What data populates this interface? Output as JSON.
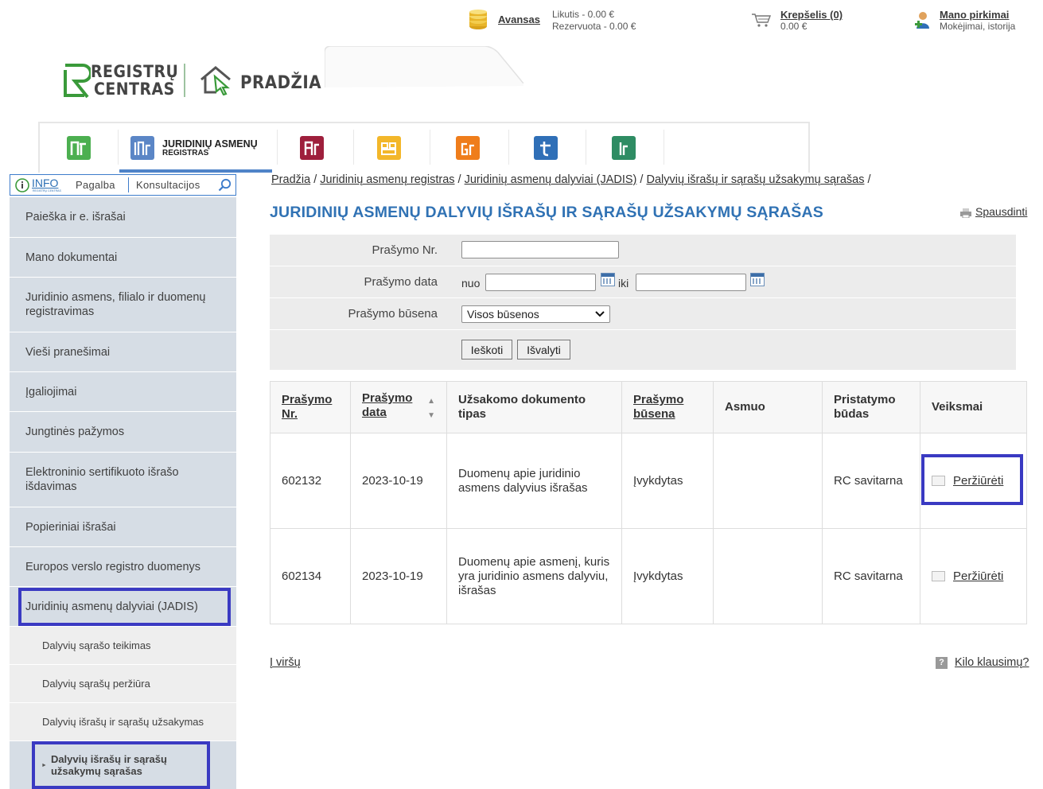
{
  "topbar": {
    "avansas_label": "Avansas",
    "balance_line": "Likutis - 0.00 €",
    "reserved_line": "Rezervuota - 0.00 €",
    "cart_label": "Krepšelis (0)",
    "cart_sum": "0.00 €",
    "purchases_label": "Mano pirkimai",
    "purchases_sub": "Mokėjimai, istorija"
  },
  "logo": {
    "line1": "REGISTRŲ",
    "line2": "CENTRAS",
    "home": "PRADŽIA"
  },
  "registry_tabs": {
    "active_line1": "JURIDINIŲ ASMENŲ",
    "active_line2": "REGISTRAS",
    "colors": {
      "nt": "#4caf50",
      "ja": "#5b86c6",
      "ar": "#9e1f3c",
      "ct": "#f3b72a",
      "gr": "#ef7d1b",
      "t": "#2f6fb7",
      "ir": "#2e8c63"
    }
  },
  "infobar": {
    "info": "INFO",
    "info_sub": "REGISTRŲ CENTRAS",
    "help": "Pagalba",
    "consult": "Konsultacijos"
  },
  "nav": {
    "items": [
      "Paieška ir e. išrašai",
      "Mano dokumentai",
      "Juridinio asmens, filialo ir duomenų registravimas",
      "Vieši pranešimai",
      "Įgaliojimai",
      "Jungtinės pažymos",
      "Elektroninio sertifikuoto išrašo išdavimas",
      "Popieriniai išrašai",
      "Europos verslo registro duomenys",
      "Juridinių asmenų dalyviai (JADIS)"
    ],
    "subitems": [
      "Dalyvių sąrašo teikimas",
      "Dalyvių sąrašų peržiūra",
      "Dalyvių išrašų ir sąrašų užsakymas"
    ],
    "active_sub": "Dalyvių išrašų ir sąrašų užsakymų sąrašas"
  },
  "breadcrumb": {
    "items": [
      "Pradžia",
      "Juridinių asmenų registras",
      "Juridinių asmenų dalyviai (JADIS)",
      "Dalyvių išrašų ir sąrašų užsakymų sąrašas"
    ],
    "separator": "/"
  },
  "page_title": "JURIDINIŲ ASMENŲ DALYVIŲ IŠRAŠŲ IR SĄRAŠŲ UŽSAKYMŲ SĄRAŠAS",
  "print_label": "Spausdinti",
  "filter": {
    "request_no_label": "Prašymo Nr.",
    "request_no_value": "",
    "date_label": "Prašymo data",
    "from_label": "nuo",
    "from_value": "",
    "to_label": "iki",
    "to_value": "",
    "status_label": "Prašymo būsena",
    "status_value": "Visos būsenos",
    "search_button": "Ieškoti",
    "clear_button": "Išvalyti"
  },
  "table": {
    "headers": {
      "no_1": "Prašymo",
      "no_2": "Nr.",
      "date_1": "Prašymo",
      "date_2": "data",
      "doc_type": "Užsakomo dokumento tipas",
      "status_1": "Prašymo",
      "status_2": "būsena",
      "person": "Asmuo",
      "delivery": "Pristatymo būdas",
      "actions": "Veiksmai"
    },
    "rows": [
      {
        "no": "602132",
        "date": "2023-10-19",
        "doc_type": "Duomenų apie juridinio asmens dalyvius išrašas",
        "status": "Įvykdytas",
        "person": "",
        "delivery": "RC savitarna",
        "action": "Peržiūrėti"
      },
      {
        "no": "602134",
        "date": "2023-10-19",
        "doc_type": "Duomenų apie asmenį, kuris yra juridinio asmens dalyviu, išrašas",
        "status": "Įvykdytas",
        "person": "",
        "delivery": "RC savitarna",
        "action": "Peržiūrėti"
      }
    ]
  },
  "footer": {
    "top_link": "Į viršų",
    "faq_link": "Kilo klausimų?"
  },
  "highlight_color": "#3a3ac2"
}
